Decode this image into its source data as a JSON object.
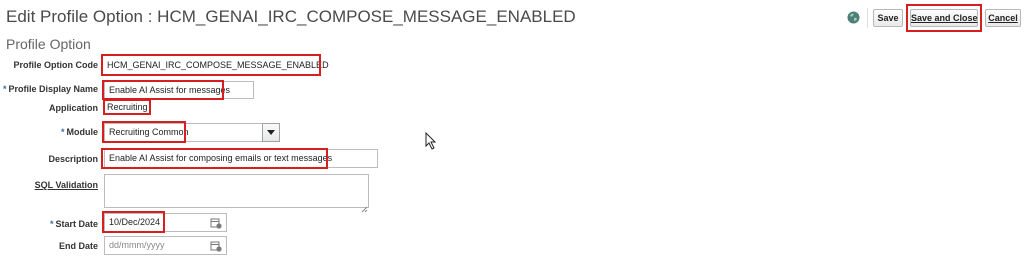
{
  "header": {
    "title": "Edit Profile Option : HCM_GENAI_IRC_COMPOSE_MESSAGE_ENABLED",
    "section": "Profile Option"
  },
  "toolbar": {
    "help_icon": "help-globe-icon",
    "save_label": "Save",
    "save_close_label": "Save and Close",
    "cancel_label": "Cancel"
  },
  "form": {
    "profile_option_code": {
      "label": "Profile Option Code",
      "value": "HCM_GENAI_IRC_COMPOSE_MESSAGE_ENABLED"
    },
    "profile_display_name": {
      "label": "Profile Display Name",
      "required": "*",
      "value": "Enable AI Assist for messages"
    },
    "application": {
      "label": "Application",
      "value": "Recruiting"
    },
    "module": {
      "label": "Module",
      "required": "*",
      "value": "Recruiting Common"
    },
    "description": {
      "label": "Description",
      "value": "Enable AI Assist for composing emails or text messages"
    },
    "sql_validation": {
      "label": "SQL Validation",
      "value": ""
    },
    "start_date": {
      "label": "Start Date",
      "required": "*",
      "value": "10/Dec/2024"
    },
    "end_date": {
      "label": "End Date",
      "placeholder": "dd/mmm/yyyy",
      "value": ""
    }
  },
  "colors": {
    "highlight": "#d62020",
    "required": "#3a6ea5"
  }
}
